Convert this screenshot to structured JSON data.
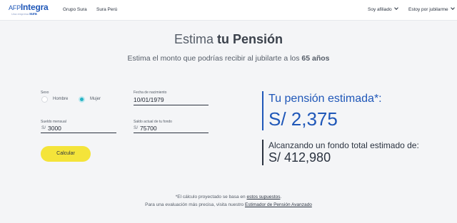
{
  "header": {
    "logo_prefix": "AFP",
    "logo_name": "Integra",
    "logo_tagline": "Una empresa",
    "logo_brand": "sura",
    "nav": [
      "Grupo Sura",
      "Sura Perú"
    ],
    "menu_afiliado": "Soy afiliado",
    "menu_jubilarme": "Estoy por jubilarme"
  },
  "hero": {
    "title_light": "Estima ",
    "title_bold": "tu Pensión",
    "subtitle_text": "Estima el monto que podrías recibir al jubilarte a los ",
    "subtitle_bold": "65 años"
  },
  "form": {
    "sexo_label": "Sexo",
    "option_hombre": "Hombre",
    "option_mujer": "Mujer",
    "selected": "Mujer",
    "fecha_label": "Fecha de nacimiento",
    "fecha_value": "10/01/1979",
    "sueldo_label": "Sueldo mensual",
    "sueldo_prefix": "S/",
    "sueldo_value": "3000",
    "saldo_label": "Saldo actual de tu fondo",
    "saldo_prefix": "S/",
    "saldo_value": "75700",
    "calcular_label": "Calcular"
  },
  "result": {
    "pension_label": "Tu pensión estimada",
    "pension_asterisk": "*:",
    "pension_value": "S/ 2,375",
    "fondo_label": "Alcanzando un fondo total estimado de:",
    "fondo_value": "S/ 412,980"
  },
  "footer": {
    "note1_text": "*El cálculo proyectado se basa en ",
    "note1_link": "estos supuestos",
    "note1_end": ".",
    "note2_text": "Para una evaluación más precisa, visita nuestro ",
    "note2_link": "Estimador de Pensión Avanzado"
  },
  "colors": {
    "brand_blue": "#1f57b8",
    "accent_yellow": "#f4e43a",
    "radio_teal": "#27b3c4"
  }
}
